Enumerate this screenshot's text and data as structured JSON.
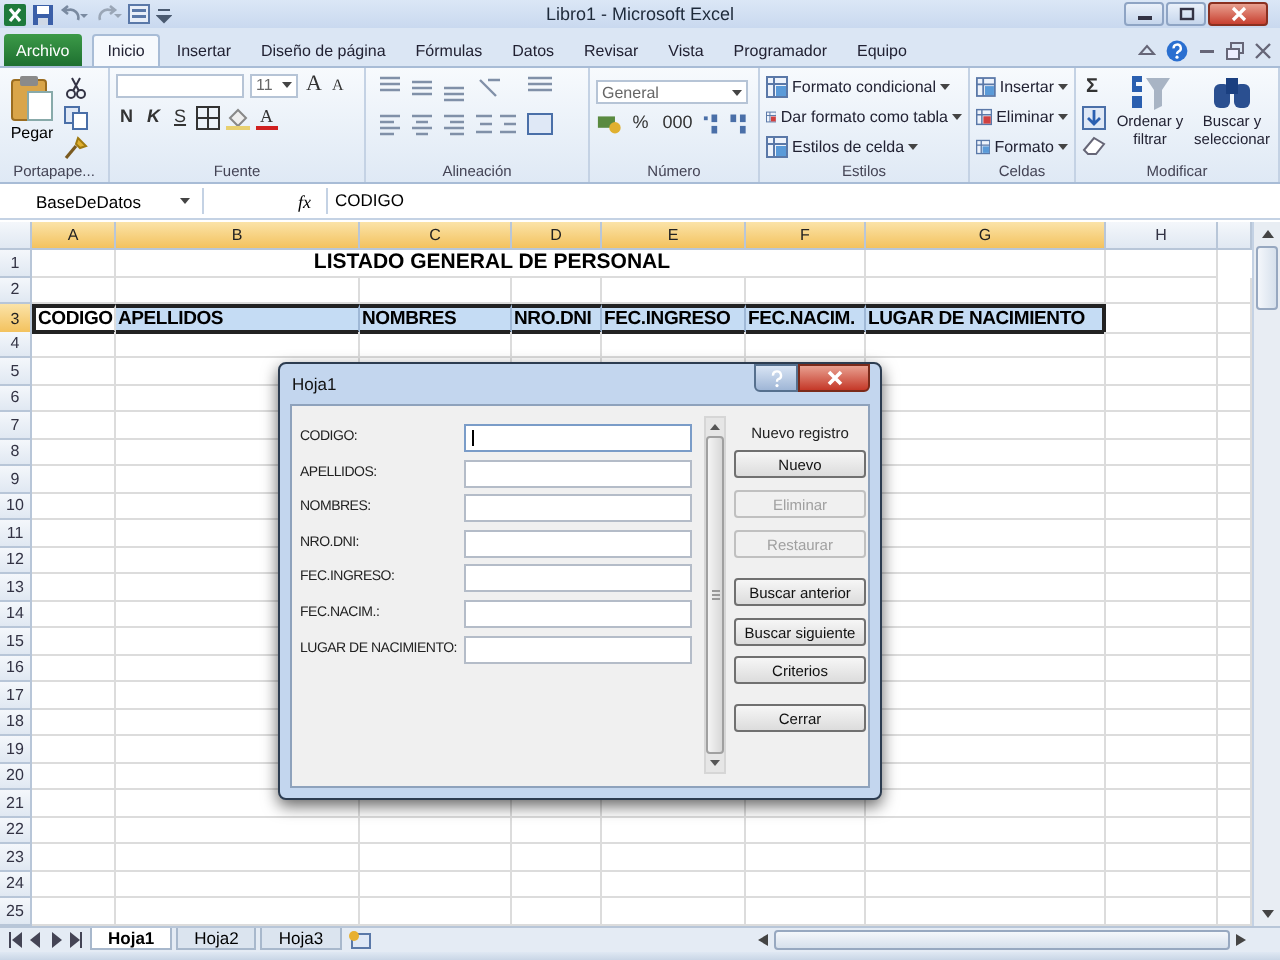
{
  "window": {
    "title": "Libro1 - Microsoft Excel"
  },
  "ribbon": {
    "file_tab": "Archivo",
    "tabs": [
      {
        "label": "Inicio",
        "selected": true
      },
      {
        "label": "Insertar",
        "selected": false
      },
      {
        "label": "Diseño de página",
        "selected": false
      },
      {
        "label": "Fórmulas",
        "selected": false
      },
      {
        "label": "Datos",
        "selected": false
      },
      {
        "label": "Revisar",
        "selected": false
      },
      {
        "label": "Vista",
        "selected": false
      },
      {
        "label": "Programador",
        "selected": false
      },
      {
        "label": "Equipo",
        "selected": false
      }
    ],
    "groups": [
      {
        "kind": "clipboard",
        "label": "Portapape...",
        "paste": "Pegar"
      },
      {
        "kind": "font",
        "label": "Fuente",
        "size": "11",
        "grow": "A",
        "shrink": "A",
        "bold": "N",
        "italic": "K",
        "underline": "S",
        "font_color": "A"
      },
      {
        "kind": "alignment",
        "label": "Alineación"
      },
      {
        "kind": "number",
        "label": "Número",
        "format": "General",
        "percent": "%",
        "thousands": "000"
      },
      {
        "kind": "list",
        "label": "Estilos",
        "items": [
          "Formato condicional",
          "Dar formato como tabla",
          "Estilos de celda"
        ]
      },
      {
        "kind": "list",
        "label": "Celdas",
        "items": [
          "Insertar",
          "Eliminar",
          "Formato"
        ]
      },
      {
        "kind": "editing",
        "label": "Modificar",
        "sum": "Σ",
        "sort": "Ordenar y filtrar",
        "find": "Buscar y seleccionar"
      }
    ]
  },
  "formula_bar": {
    "name_box": "BaseDeDatos",
    "fx": "fx",
    "content": "CODIGO"
  },
  "sheet": {
    "columns": [
      {
        "label": "A",
        "selected": true
      },
      {
        "label": "B",
        "selected": true
      },
      {
        "label": "C",
        "selected": true
      },
      {
        "label": "D",
        "selected": true
      },
      {
        "label": "E",
        "selected": true
      },
      {
        "label": "F",
        "selected": true
      },
      {
        "label": "G",
        "selected": true
      },
      {
        "label": "H",
        "selected": false
      }
    ],
    "rows": [
      {
        "label": "1",
        "selected": false
      },
      {
        "label": "2",
        "selected": false
      },
      {
        "label": "3",
        "selected": true
      },
      {
        "label": "4",
        "selected": false
      },
      {
        "label": "5",
        "selected": false
      },
      {
        "label": "6",
        "selected": false
      },
      {
        "label": "7",
        "selected": false
      },
      {
        "label": "8",
        "selected": false
      },
      {
        "label": "9",
        "selected": false
      },
      {
        "label": "10",
        "selected": false
      },
      {
        "label": "11",
        "selected": false
      },
      {
        "label": "12",
        "selected": false
      },
      {
        "label": "13",
        "selected": false
      },
      {
        "label": "14",
        "selected": false
      },
      {
        "label": "15",
        "selected": false
      },
      {
        "label": "16",
        "selected": false
      },
      {
        "label": "17",
        "selected": false
      },
      {
        "label": "18",
        "selected": false
      },
      {
        "label": "19",
        "selected": false
      },
      {
        "label": "20",
        "selected": false
      },
      {
        "label": "21",
        "selected": false
      },
      {
        "label": "22",
        "selected": false
      },
      {
        "label": "23",
        "selected": false
      },
      {
        "label": "24",
        "selected": false
      },
      {
        "label": "25",
        "selected": false
      }
    ],
    "title": "LISTADO GENERAL DE PERSONAL",
    "header_row": [
      {
        "text": "CODIGO",
        "active": true
      },
      {
        "text": "APELLIDOS",
        "active": false
      },
      {
        "text": "NOMBRES",
        "active": false
      },
      {
        "text": "NRO.DNI",
        "active": false
      },
      {
        "text": "FEC.INGRESO",
        "active": false
      },
      {
        "text": "FEC.NACIM.",
        "active": false
      },
      {
        "text": "LUGAR DE NACIMIENTO",
        "active": false
      }
    ]
  },
  "dialog": {
    "title": "Hoja1",
    "fields": [
      {
        "label": "CODIGO:",
        "focused": true
      },
      {
        "label": "APELLIDOS:",
        "focused": false
      },
      {
        "label": "NOMBRES:",
        "focused": false
      },
      {
        "label": "NRO.DNI:",
        "focused": false
      },
      {
        "label": "FEC.INGRESO:",
        "focused": false
      },
      {
        "label": "FEC.NACIM.:",
        "focused": false
      },
      {
        "label": "LUGAR DE NACIMIENTO:",
        "focused": false
      }
    ],
    "record_label": "Nuevo registro",
    "buttons": [
      {
        "label": "Nuevo",
        "disabled": false
      },
      {
        "label": "Eliminar",
        "disabled": true
      },
      {
        "label": "Restaurar",
        "disabled": true
      },
      {
        "label": "Buscar anterior",
        "disabled": false
      },
      {
        "label": "Buscar siguiente",
        "disabled": false
      },
      {
        "label": "Criterios",
        "disabled": false
      },
      {
        "label": "Cerrar",
        "disabled": false
      }
    ]
  },
  "sheet_tabs": [
    {
      "label": "Hoja1",
      "selected": true
    },
    {
      "label": "Hoja2",
      "selected": false
    },
    {
      "label": "Hoja3",
      "selected": false
    }
  ]
}
